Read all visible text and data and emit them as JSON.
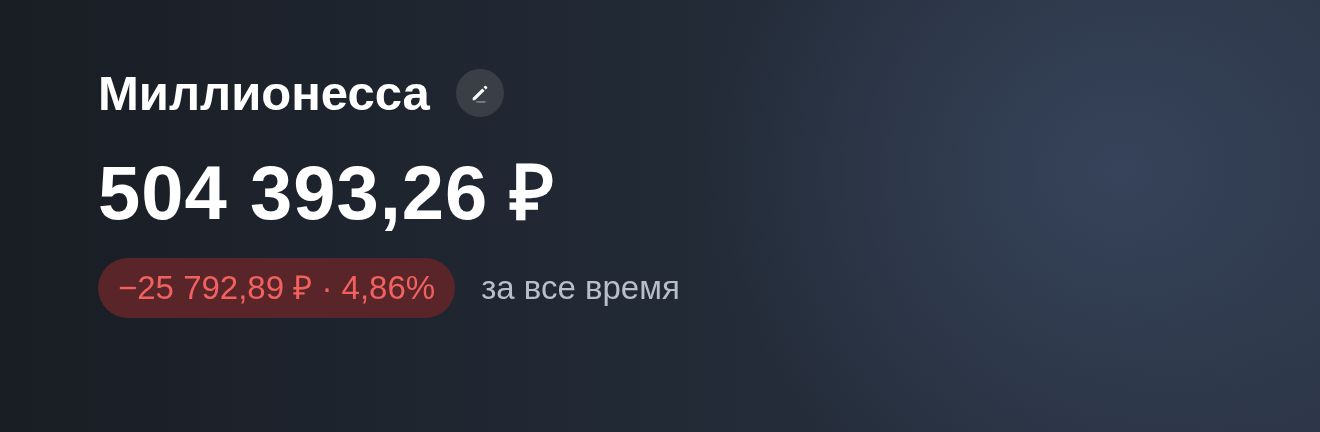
{
  "account": {
    "name": "Миллионесса",
    "balance": "504 393,26 ₽"
  },
  "change": {
    "text": "−25 792,89 ₽ · 4,86%",
    "kind": "loss",
    "period": "за все время"
  }
}
